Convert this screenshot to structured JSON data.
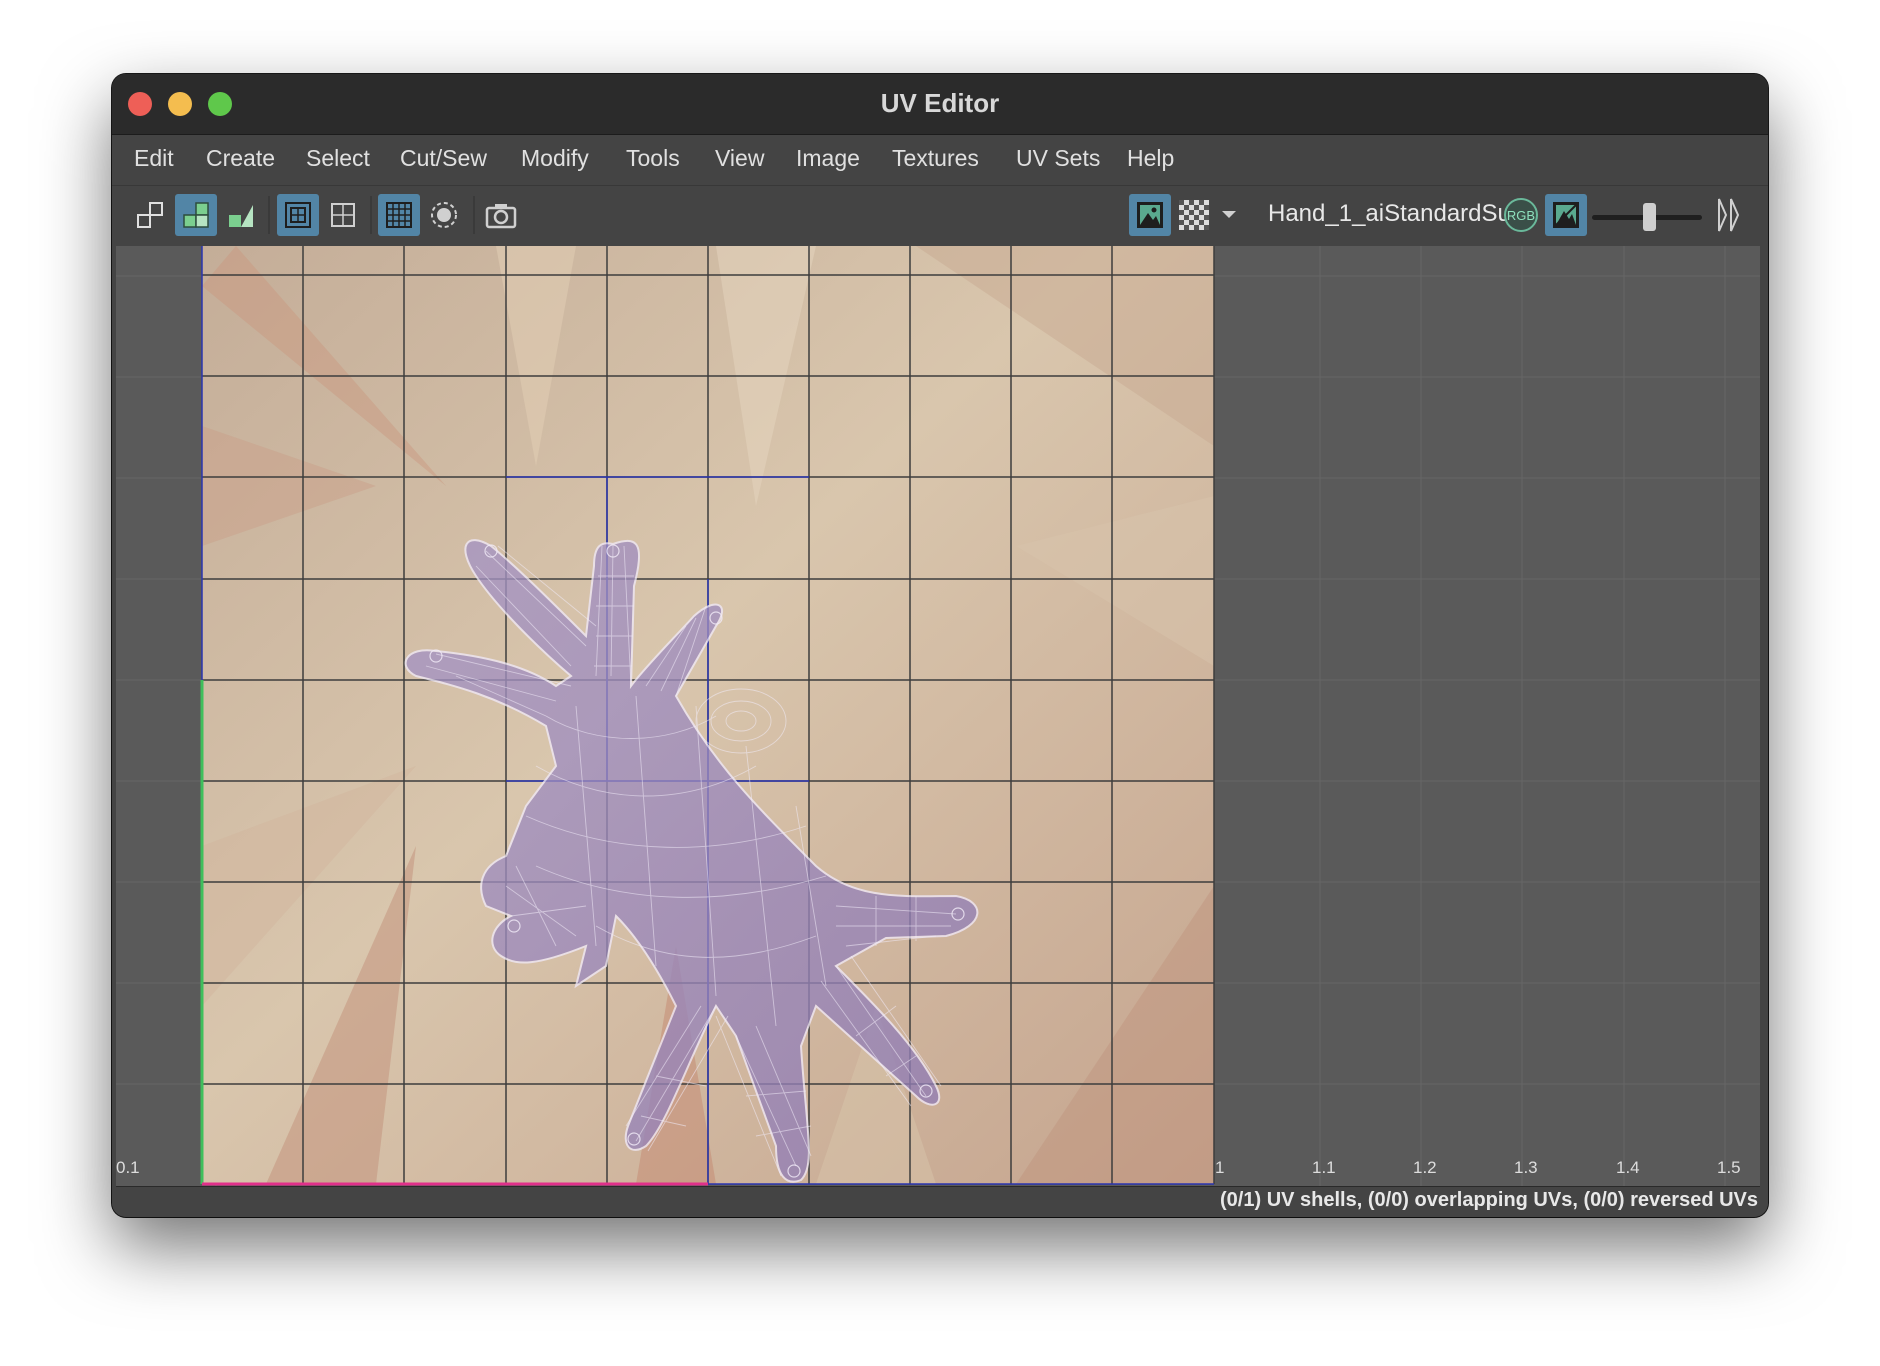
{
  "window": {
    "title": "UV Editor"
  },
  "menu": [
    "Edit",
    "Create",
    "Select",
    "Cut/Sew",
    "Modify",
    "Tools",
    "View",
    "Image",
    "Textures",
    "UV Sets",
    "Help"
  ],
  "toolbar": {
    "left_tools": [
      {
        "icon": "uv-layout-icon",
        "active": false
      },
      {
        "icon": "uv-tile-icon",
        "active": true
      },
      {
        "icon": "uv-stack-icon",
        "active": false
      },
      {
        "icon": "frame-all-icon",
        "active": true
      },
      {
        "icon": "frame-selection-icon",
        "active": false
      },
      {
        "icon": "grid-icon",
        "active": true
      },
      {
        "icon": "isolate-icon",
        "active": false
      },
      {
        "icon": "snapshot-camera-icon",
        "active": false
      }
    ],
    "right_tools": [
      {
        "icon": "display-image-icon",
        "active": true
      },
      {
        "icon": "checker-icon",
        "active": false
      },
      {
        "icon": "chevron-down-icon",
        "active": false
      }
    ],
    "shader_name": "Hand_1_aiStandardSu",
    "rgb_label": "RGB",
    "exposure_slider_value": 0.55
  },
  "viewport": {
    "u_tick_labels": [
      "0.1",
      "1",
      "1.1",
      "1.2",
      "1.3",
      "1.4",
      "1.5"
    ],
    "texture_colors": {
      "base": "#cdb59f",
      "uv_shell": "#9b86b8",
      "grid_line": "#3a3a3a",
      "uv_axis_u": "#e0308a",
      "uv_axis_v": "#3fbf5c"
    }
  },
  "status": {
    "text": "(0/1) UV shells, (0/0) overlapping UVs, (0/0) reversed UVs"
  }
}
